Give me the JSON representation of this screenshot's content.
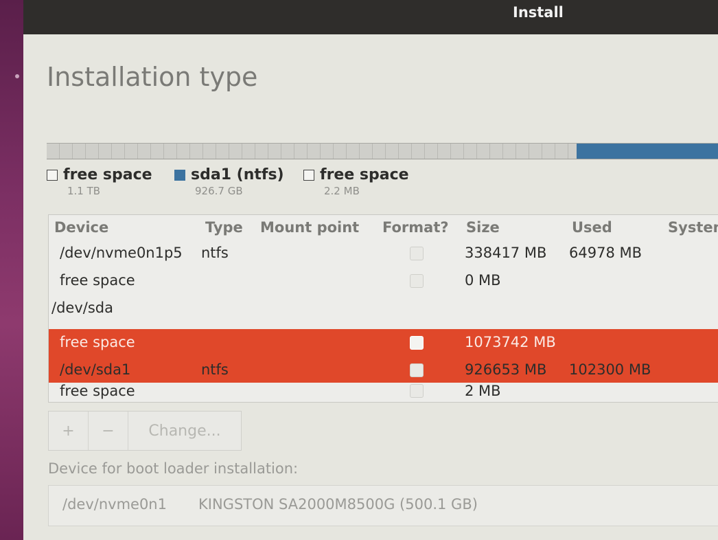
{
  "window": {
    "title": "Install"
  },
  "page": {
    "title": "Installation type"
  },
  "legend": [
    {
      "label": "free space",
      "size": "1.1 TB",
      "swatch": "empty"
    },
    {
      "label": "sda1 (ntfs)",
      "size": "926.7 GB",
      "swatch": "filled"
    },
    {
      "label": "free space",
      "size": "2.2 MB",
      "swatch": "empty"
    }
  ],
  "table": {
    "headers": {
      "device": "Device",
      "type": "Type",
      "mount_point": "Mount point",
      "format": "Format?",
      "size": "Size",
      "used": "Used",
      "system": "System"
    },
    "rows": [
      {
        "device": "/dev/nvme0n1p5",
        "type": "ntfs",
        "size": "338417 MB",
        "used": "64978 MB",
        "has_checkbox": true,
        "selected": false
      },
      {
        "device": "free space",
        "type": "",
        "size": "0 MB",
        "used": "",
        "has_checkbox": true,
        "selected": false
      },
      {
        "device": "/dev/sda",
        "type": "",
        "size": "",
        "used": "",
        "has_checkbox": false,
        "selected": false
      },
      {
        "device": "free space",
        "type": "",
        "size": "1073742 MB",
        "used": "",
        "has_checkbox": true,
        "selected": true
      },
      {
        "device": "/dev/sda1",
        "type": "ntfs",
        "size": "926653 MB",
        "used": "102300 MB",
        "has_checkbox": true,
        "selected": false
      },
      {
        "device": "free space",
        "type": "",
        "size": "2 MB",
        "used": "",
        "has_checkbox": true,
        "selected": false
      }
    ]
  },
  "buttons": {
    "add": "+",
    "remove": "−",
    "change": "Change..."
  },
  "bootloader": {
    "label": "Device for boot loader installation:",
    "device": "/dev/nvme0n1",
    "description": "KINGSTON SA2000M8500G (500.1 GB)"
  },
  "colors": {
    "selection": "#e0482a",
    "partition_used": "#3c73a0",
    "titlebar": "#2f2d2b"
  }
}
